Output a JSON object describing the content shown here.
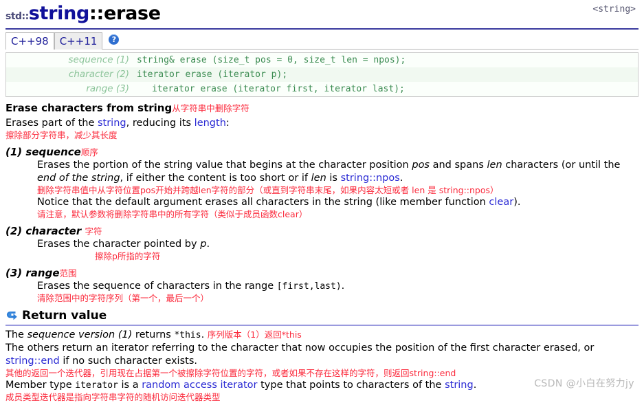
{
  "header": {
    "std_prefix": "std::",
    "class_name": "string",
    "member_name": "::erase",
    "include_header": "<string>"
  },
  "tabs": [
    {
      "label": "C++98",
      "active": true
    },
    {
      "label": "C++11",
      "active": false
    }
  ],
  "help_icon_label": "?",
  "signatures": [
    {
      "label": "sequence",
      "num": "(1)",
      "code": "string& erase (size_t pos = 0, size_t len = npos);"
    },
    {
      "label": "character",
      "num": "(2)",
      "code": "iterator erase (iterator p);"
    },
    {
      "label": "range",
      "num": "(3)",
      "code": "iterator erase (iterator first, iterator last);"
    }
  ],
  "description": {
    "heading_en": "Erase characters from string",
    "heading_zh": "从字符串中删除字符",
    "intro_pre": "Erases part of the ",
    "intro_link1": "string",
    "intro_mid": ", reducing its ",
    "intro_link2": "length",
    "intro_post": ":",
    "intro_zh": "擦除部分字符串，减少其长度"
  },
  "sections": [
    {
      "num": "(1)",
      "name": "sequence",
      "name_zh": "顺序",
      "body_parts": {
        "p1a": "Erases the portion of the string value that begins at the character position ",
        "p1_pos": "pos",
        "p1b": " and spans ",
        "p1_len": "len",
        "p1c": " characters (or until the ",
        "p1_eos": "end of the string",
        "p1d": ", if either the content is too short or if ",
        "p1_len2": "len",
        "p1e": " is ",
        "p1_npos": "string::npos",
        "p1f": "."
      },
      "body_zh": "删除字符串值中从字符位置pos开始并跨越len字符的部分（或直到字符串末尾，如果内容太短或者 len 是 string::npos）",
      "note_pre": "Notice that the default argument erases all characters in the string (like member function ",
      "note_link": "clear",
      "note_post": ").",
      "note_zh": "请注意，默认参数将删除字符串中的所有字符（类似于成员函数clear）"
    },
    {
      "num": "(2)",
      "name": "character",
      "name_zh": "字符",
      "body_pre": "Erases the character pointed by ",
      "body_ital": "p",
      "body_post": ".",
      "body_zh": "擦除p所指的字符"
    },
    {
      "num": "(3)",
      "name": "range",
      "name_zh": "范围",
      "body_pre": "Erases the sequence of characters in the range ",
      "body_mono": "[first,last)",
      "body_post": ".",
      "body_zh": "清除范围中的字符序列（第一个，最后一个）"
    }
  ],
  "return_value": {
    "icon": "return-arrow-icon",
    "heading": "Return value",
    "line1_pre": "The ",
    "line1_ital": "sequence version (1)",
    "line1_mid": " returns ",
    "line1_mono": "*this",
    "line1_post": ".",
    "line1_zh": "序列版本（1）返回*this",
    "line2": "The others return an iterator referring to the character that now occupies the position of the first character erased, or",
    "line3_link": "string::end",
    "line3_post": " if no such character exists.",
    "line23_zh": "其他的返回一个迭代器，引用现在占据第一个被擦除字符位置的字符，或者如果不存在这样的字符，则返回string::end",
    "line4_pre": "Member type ",
    "line4_mono": "iterator",
    "line4_mid": " is a ",
    "line4_link": "random access iterator",
    "line4_post": " type that points to characters of the ",
    "line4_link2": "string",
    "line4_end": ".",
    "line4_zh": "成员类型迭代器是指向字符串字符的随机访问迭代器类型"
  },
  "watermark": "CSDN @小白在努力jy",
  "colors": {
    "title_class": "#10109a",
    "link": "#2b2bd4",
    "annotation_red": "#fb2a3c",
    "signature_green": "#3c8c52",
    "signature_label_green": "#8cc49a",
    "rule_blue": "#3a3a9e",
    "rule_light_blue": "#9a9ade",
    "watermark_gray": "#b8b8b8"
  }
}
